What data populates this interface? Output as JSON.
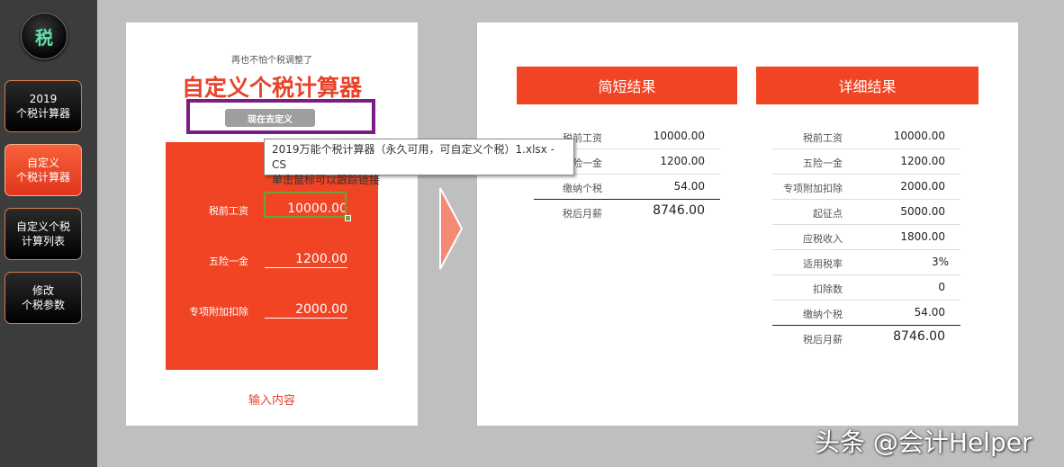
{
  "sidebar": {
    "logo": "税",
    "items": [
      {
        "label": "2019\n个税计算器",
        "active": false
      },
      {
        "label": "自定义\n个税计算器",
        "active": true
      },
      {
        "label": "自定义个税\n计算列表",
        "active": false
      },
      {
        "label": "修改\n个税参数",
        "active": false
      }
    ]
  },
  "input_panel": {
    "subtitle": "再也不怕个税调整了",
    "title": "自定义个税计算器",
    "define_button": "现在去定义",
    "fields": [
      {
        "label": "税前工资",
        "value": "10000.00"
      },
      {
        "label": "五险一金",
        "value": "1200.00"
      },
      {
        "label": "专项附加扣除",
        "value": "2000.00"
      }
    ],
    "caption": "输入内容"
  },
  "tooltip": {
    "line1": "2019万能个税计算器（永久可用，可自定义个税）1.xlsx - CS",
    "line2": "单击鼠标可以跟踪链接"
  },
  "short_result": {
    "header": "简短结果",
    "rows": [
      {
        "label": "税前工资",
        "value": "10000.00"
      },
      {
        "label": "五险一金",
        "value": "1200.00"
      },
      {
        "label": "缴纳个税",
        "value": "54.00"
      },
      {
        "label": "税后月薪",
        "value": "8746.00"
      }
    ]
  },
  "detail_result": {
    "header": "详细结果",
    "rows": [
      {
        "label": "税前工资",
        "value": "10000.00"
      },
      {
        "label": "五险一金",
        "value": "1200.00"
      },
      {
        "label": "专项附加扣除",
        "value": "2000.00"
      },
      {
        "label": "起征点",
        "value": "5000.00"
      },
      {
        "label": "应税收入",
        "value": "1800.00"
      },
      {
        "label": "适用税率",
        "value": "3%"
      },
      {
        "label": "扣除数",
        "value": "0"
      },
      {
        "label": "缴纳个税",
        "value": "54.00"
      },
      {
        "label": "税后月薪",
        "value": "8746.00"
      }
    ]
  },
  "watermark": "头条 @会计Helper",
  "colors": {
    "accent": "#f04424",
    "highlight_border": "#7a1e86",
    "selection": "#6ea23b",
    "sidebar_bg": "#3c3c3c"
  }
}
